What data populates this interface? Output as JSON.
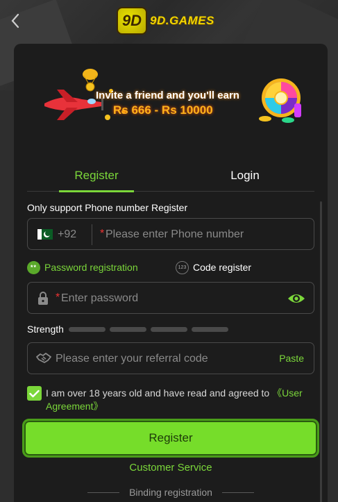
{
  "header": {
    "brand_mark": "9D",
    "brand_name": "9D.GAMES"
  },
  "banner": {
    "line1": "Invite a friend and you'll earn",
    "line2": "Rs 666 - Rs 10000"
  },
  "tabs": [
    {
      "label": "Register",
      "active": true
    },
    {
      "label": "Login",
      "active": false
    }
  ],
  "form": {
    "note": "Only support Phone number Register",
    "phone": {
      "country_code": "+92",
      "required_mark": "*",
      "placeholder": "Please enter Phone number"
    },
    "modes": {
      "password_label": "Password registration",
      "password_icon_text": "**",
      "code_label": "Code register",
      "code_icon_text": "123"
    },
    "password": {
      "required_mark": "*",
      "placeholder": "Enter password"
    },
    "strength_label": "Strength",
    "referral": {
      "placeholder": "Please enter your referral code",
      "paste_label": "Paste"
    },
    "agreement": {
      "text": "I am over 18 years old and have read and agreed to ",
      "link": "《User Agreement》",
      "checked": true
    },
    "submit_label": "Register",
    "customer_service": "Customer Service",
    "binding_registration": "Binding registration"
  },
  "colors": {
    "accent": "#7bd73a",
    "button": "#76dd2a",
    "card": "#1c1c1c",
    "background": "#2b2b2b"
  }
}
